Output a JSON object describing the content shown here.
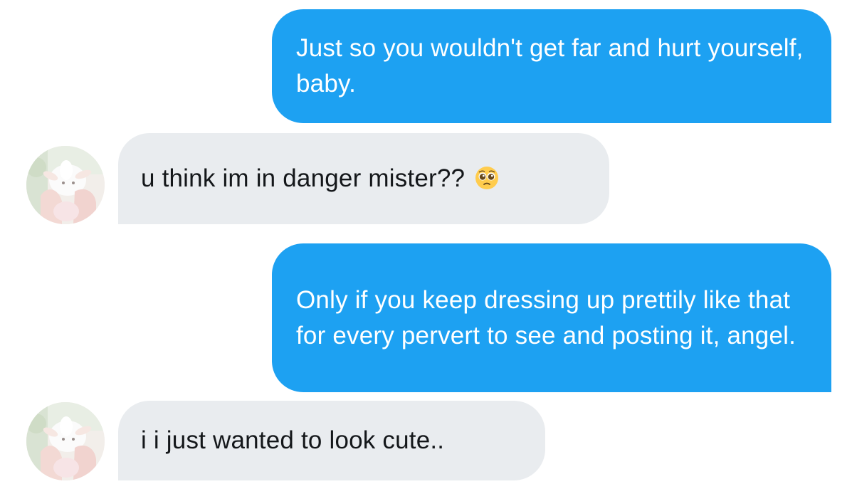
{
  "conversation": {
    "messages": [
      {
        "direction": "outgoing",
        "text": "Just so you wouldn't get far and hurt yourself, baby."
      },
      {
        "direction": "incoming",
        "text": "u think im in danger mister??",
        "emoji": "pleading-face-emoji"
      },
      {
        "direction": "outgoing",
        "text": "Only if you keep dressing up prettily like that for every pervert to see and posting it, angel."
      },
      {
        "direction": "incoming",
        "text": "i i just wanted to look cute.."
      }
    ]
  },
  "colors": {
    "outgoing_bubble": "#1da1f2",
    "incoming_bubble": "#e9ecef",
    "outgoing_text": "#ffffff",
    "incoming_text": "#14171a",
    "background": "#ffffff"
  },
  "icons": {
    "avatar": "goat-photo-avatar",
    "emoji": "pleading-face-emoji"
  }
}
